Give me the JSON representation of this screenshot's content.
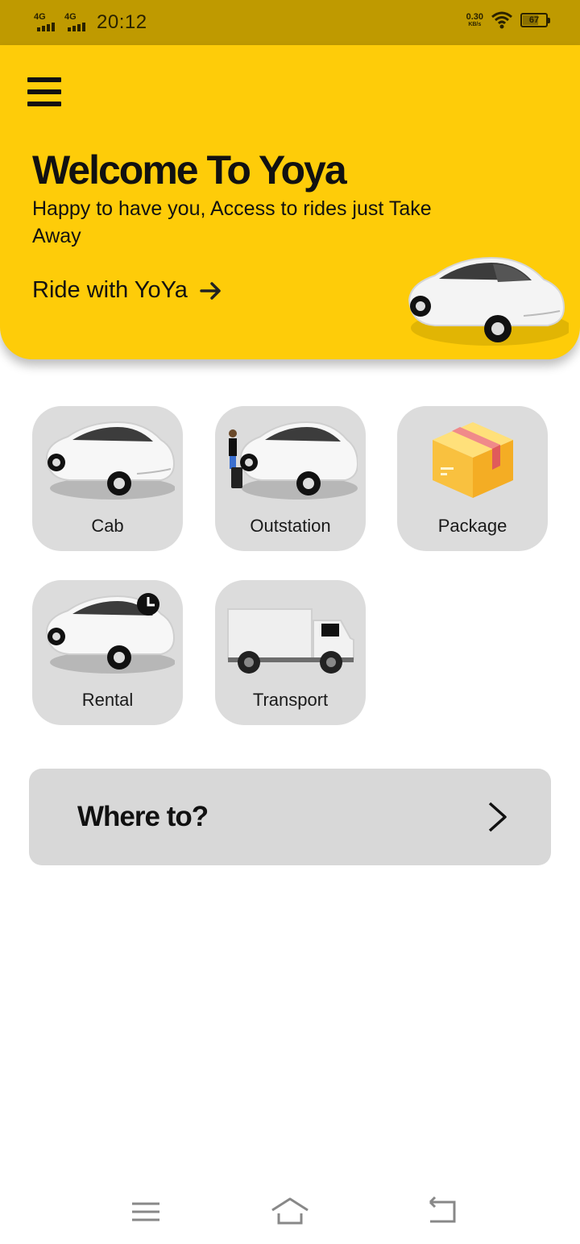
{
  "status_bar": {
    "network_1": "4G",
    "network_2": "4G",
    "time": "20:12",
    "speed_value": "0.30",
    "speed_unit": "KB/s",
    "battery": "67"
  },
  "hero": {
    "title": "Welcome To Yoya",
    "subtitle": "Happy to have you, Access to rides just Take Away",
    "ride_link": "Ride with YoYa"
  },
  "services": [
    {
      "label": "Cab",
      "icon": "car-icon"
    },
    {
      "label": "Outstation",
      "icon": "car-with-traveler-icon"
    },
    {
      "label": "Package",
      "icon": "package-box-icon"
    },
    {
      "label": "Rental",
      "icon": "car-with-clock-icon"
    },
    {
      "label": "Transport",
      "icon": "truck-icon"
    }
  ],
  "where_to": {
    "label": "Where to?"
  },
  "colors": {
    "brand_yellow": "#fecc09",
    "status_bar": "#bf9a00",
    "tile_gray": "#dcdcdc"
  }
}
